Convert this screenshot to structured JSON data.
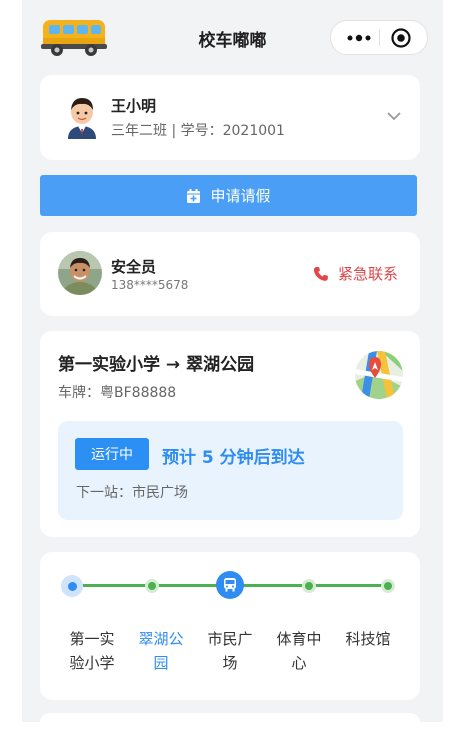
{
  "header": {
    "title": "校车嘟嘟",
    "more_icon": "more-dots-icon",
    "close_icon": "target-icon"
  },
  "student": {
    "name": "王小明",
    "info": "三年二班 | 学号：2021001"
  },
  "leave_button": {
    "label": "申请请假",
    "icon": "calendar-add-icon"
  },
  "safety_officer": {
    "name": "安全员",
    "phone": "138****5678",
    "emergency_label": "紧急联系",
    "emergency_color": "#e0474b"
  },
  "route": {
    "title": "第一实验小学 → 翠湖公园",
    "plate": "车牌：粤BF88888",
    "status_badge": "运行中",
    "eta": "预计 5 分钟后到达",
    "next_stop": "下一站：市民广场",
    "accent": "#2f8cf0"
  },
  "stops": [
    {
      "name": "第一实验小学",
      "line1": "第一实",
      "line2": "验小学",
      "state": "passed"
    },
    {
      "name": "翠湖公园",
      "line1": "翠湖公",
      "line2": "园",
      "state": "current"
    },
    {
      "name": "市民广场",
      "line1": "市民广",
      "line2": "场",
      "state": "bus"
    },
    {
      "name": "体育中心",
      "line1": "体育中",
      "line2": "心",
      "state": "upcoming"
    },
    {
      "name": "科技馆",
      "line1": "科技馆",
      "line2": "",
      "state": "upcoming"
    }
  ]
}
